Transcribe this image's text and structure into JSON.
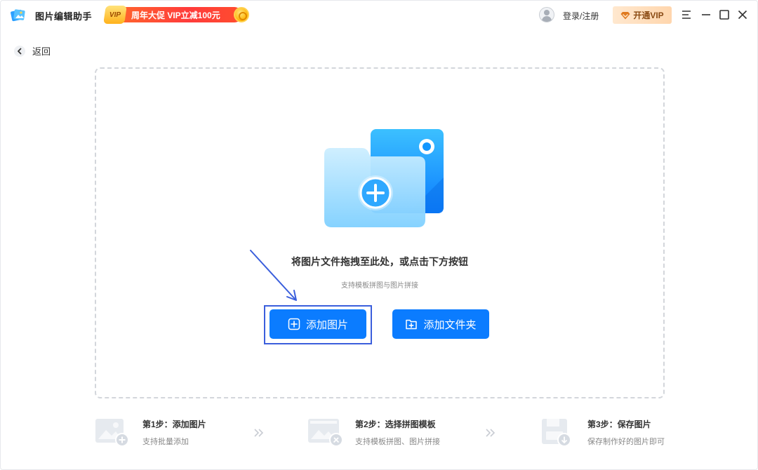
{
  "app": {
    "title": "图片编辑助手"
  },
  "promo": {
    "badge": "VIP",
    "text": "周年大促 VIP立减100元"
  },
  "header": {
    "login_label": "登录/注册",
    "vip_button_label": "开通VIP"
  },
  "nav": {
    "back_label": "返回"
  },
  "dropzone": {
    "title": "将图片文件拖拽至此处，或点击下方按钮",
    "subtitle": "支持模板拼图与图片拼接",
    "add_image_label": "添加图片",
    "add_folder_label": "添加文件夹"
  },
  "steps": [
    {
      "title": "第1步：添加图片",
      "desc": "支持批量添加",
      "icon": "image-add-icon"
    },
    {
      "title": "第2步：选择拼图模板",
      "desc": "支持模板拼图、图片拼接",
      "icon": "template-icon"
    },
    {
      "title": "第3步：保存图片",
      "desc": "保存制作好的图片即可",
      "icon": "save-icon"
    }
  ],
  "colors": {
    "primary": "#0b7cff",
    "highlight": "#3b5fdc",
    "promo": "#ff3b3b",
    "vip_text": "#8a4b14"
  }
}
